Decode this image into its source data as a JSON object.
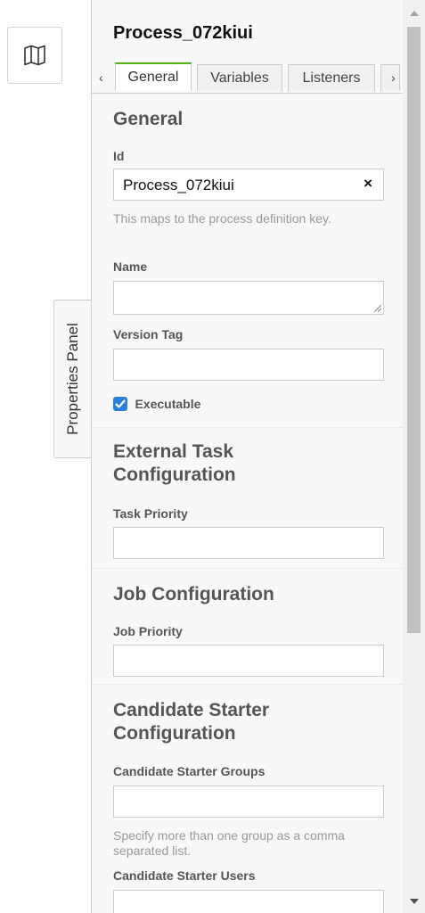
{
  "canvas": {
    "map_icon": "map-icon",
    "panel_toggle_label": "Properties Panel"
  },
  "panel": {
    "title": "Process_072kiui",
    "tabs": [
      {
        "label": "General",
        "active": true
      },
      {
        "label": "Variables",
        "active": false
      },
      {
        "label": "Listeners",
        "active": false
      }
    ],
    "tab_prev": "‹",
    "tab_next": "›",
    "general": {
      "heading": "General",
      "id_label": "Id",
      "id_value": "Process_072kiui",
      "id_clear": "×",
      "id_hint": "This maps to the process definition key.",
      "name_label": "Name",
      "name_value": "",
      "version_tag_label": "Version Tag",
      "version_tag_value": "",
      "executable_label": "Executable",
      "executable_checked": true
    },
    "external_task": {
      "heading": "External Task Configuration",
      "task_priority_label": "Task Priority",
      "task_priority_value": ""
    },
    "job": {
      "heading": "Job Configuration",
      "job_priority_label": "Job Priority",
      "job_priority_value": ""
    },
    "candidate_starter": {
      "heading": "Candidate Starter Configuration",
      "groups_label": "Candidate Starter Groups",
      "groups_value": "",
      "groups_hint": "Specify more than one group as a comma separated list.",
      "users_label": "Candidate Starter Users",
      "users_value": ""
    }
  },
  "colors": {
    "accent_tab": "#52b415",
    "checkbox": "#2a7fe0",
    "panel_bg": "#f8f8f8"
  }
}
